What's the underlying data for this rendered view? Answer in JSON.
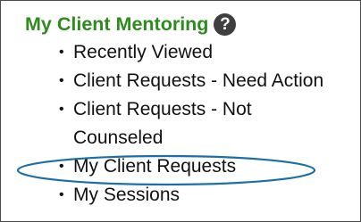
{
  "section": {
    "title": "My Client Mentoring",
    "help_symbol": "?"
  },
  "menu": {
    "bullet": "•",
    "items": [
      {
        "label": "Recently Viewed"
      },
      {
        "label": "Client Requests - Need Action"
      },
      {
        "label": "Client Requests - Not Counseled"
      },
      {
        "label": "My Client Requests",
        "highlighted": true
      },
      {
        "label": "My Sessions"
      }
    ]
  },
  "colors": {
    "title": "#2e8b1e",
    "help_icon_bg": "#3f3f3f",
    "highlight_ellipse": "#1b6fa8",
    "border": "#4a4a4a"
  },
  "icons": {
    "help": "help-question-icon"
  }
}
